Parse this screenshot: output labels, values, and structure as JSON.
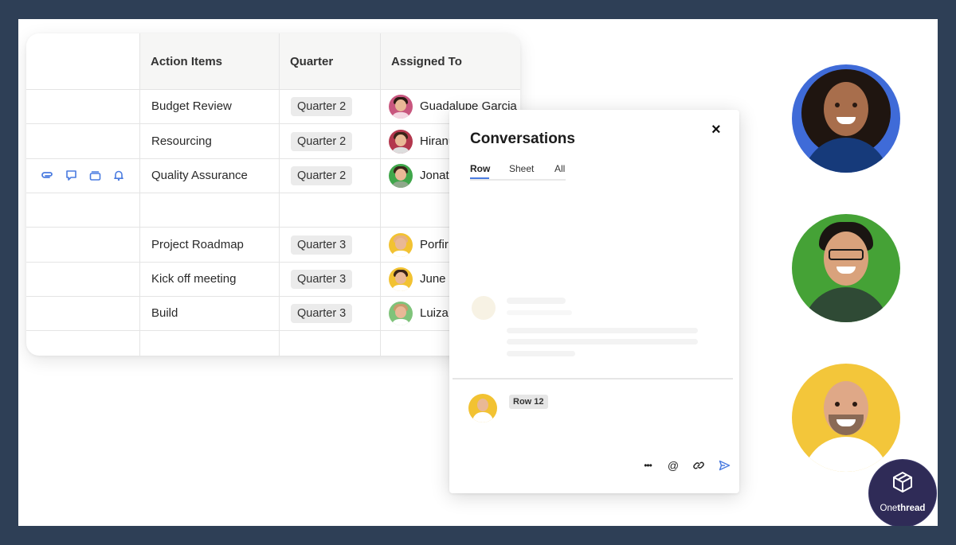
{
  "sheet": {
    "headers": {
      "action_items": "Action Items",
      "quarter": "Quarter",
      "assigned_to": "Assigned To"
    },
    "rows": [
      {
        "action": "Budget Review",
        "quarter": "Quarter 2",
        "assignee": "Guadalupe Garcia",
        "avatar_bg": "#c8567e"
      },
      {
        "action": "Resourcing",
        "quarter": "Quarter 2",
        "assignee": "Hiranu",
        "avatar_bg": "#b3374d"
      },
      {
        "action": "Quality Assurance",
        "quarter": "Quarter 2",
        "assignee": "Jonat",
        "avatar_bg": "#3fa64a"
      },
      {
        "action": "",
        "quarter": "",
        "assignee": "",
        "avatar_bg": ""
      },
      {
        "action": "Project Roadmap",
        "quarter": "Quarter 3",
        "assignee": "Porfir",
        "avatar_bg": "#f2c232"
      },
      {
        "action": "Kick off meeting",
        "quarter": "Quarter 3",
        "assignee": "June",
        "avatar_bg": "#f2c232"
      },
      {
        "action": "Build",
        "quarter": "Quarter 3",
        "assignee": "Luiza",
        "avatar_bg": "#7fc37a"
      }
    ],
    "row_action_icons": [
      "attachment-icon",
      "comment-icon",
      "proof-icon",
      "reminder-icon"
    ]
  },
  "conversations": {
    "title": "Conversations",
    "close_icon": "×",
    "tabs": [
      "Row",
      "Sheet",
      "All"
    ],
    "active_tab": "Row",
    "composer_tag": "Row 12",
    "toolbar_icons": [
      "more-icon",
      "mention-icon",
      "link-icon",
      "send-icon"
    ],
    "more_glyph": "•••",
    "mention_glyph": "@"
  },
  "people": [
    {
      "name": "person-1",
      "bg": "#3f6bd8"
    },
    {
      "name": "person-2",
      "bg": "#45a236"
    },
    {
      "name": "person-3",
      "bg": "#f3c63a"
    }
  ],
  "brand": {
    "name_light": "One",
    "name_bold": "thread"
  },
  "colors": {
    "page_border": "#2e3f56",
    "accent": "#4a7be0"
  }
}
